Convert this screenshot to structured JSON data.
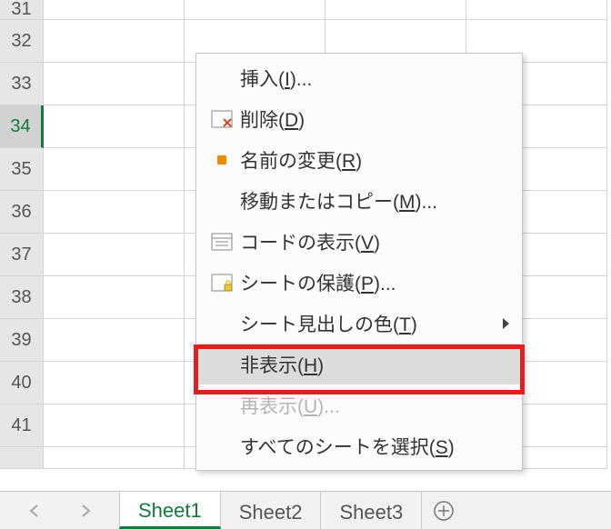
{
  "rows": [
    31,
    32,
    33,
    34,
    35,
    36,
    37,
    38,
    39,
    40,
    41
  ],
  "selectedRow": 34,
  "tabs": [
    {
      "label": "Sheet1",
      "active": true
    },
    {
      "label": "Sheet2",
      "active": false
    },
    {
      "label": "Sheet3",
      "active": false
    }
  ],
  "menu": {
    "insert": {
      "pre": "挿入(",
      "key": "I",
      "post": ")..."
    },
    "delete": {
      "pre": "削除(",
      "key": "D",
      "post": ")"
    },
    "rename": {
      "pre": "名前の変更(",
      "key": "R",
      "post": ")"
    },
    "move": {
      "pre": "移動またはコピー(",
      "key": "M",
      "post": ")..."
    },
    "code": {
      "pre": "コードの表示(",
      "key": "V",
      "post": ")"
    },
    "protect": {
      "pre": "シートの保護(",
      "key": "P",
      "post": ")..."
    },
    "tabcolor": {
      "pre": "シート見出しの色(",
      "key": "T",
      "post": ")"
    },
    "hide": {
      "pre": "非表示(",
      "key": "H",
      "post": ")"
    },
    "unhide": {
      "pre": "再表示(",
      "key": "U",
      "post": ")..."
    },
    "selectall": {
      "pre": "すべてのシートを選択(",
      "key": "S",
      "post": ")"
    }
  }
}
